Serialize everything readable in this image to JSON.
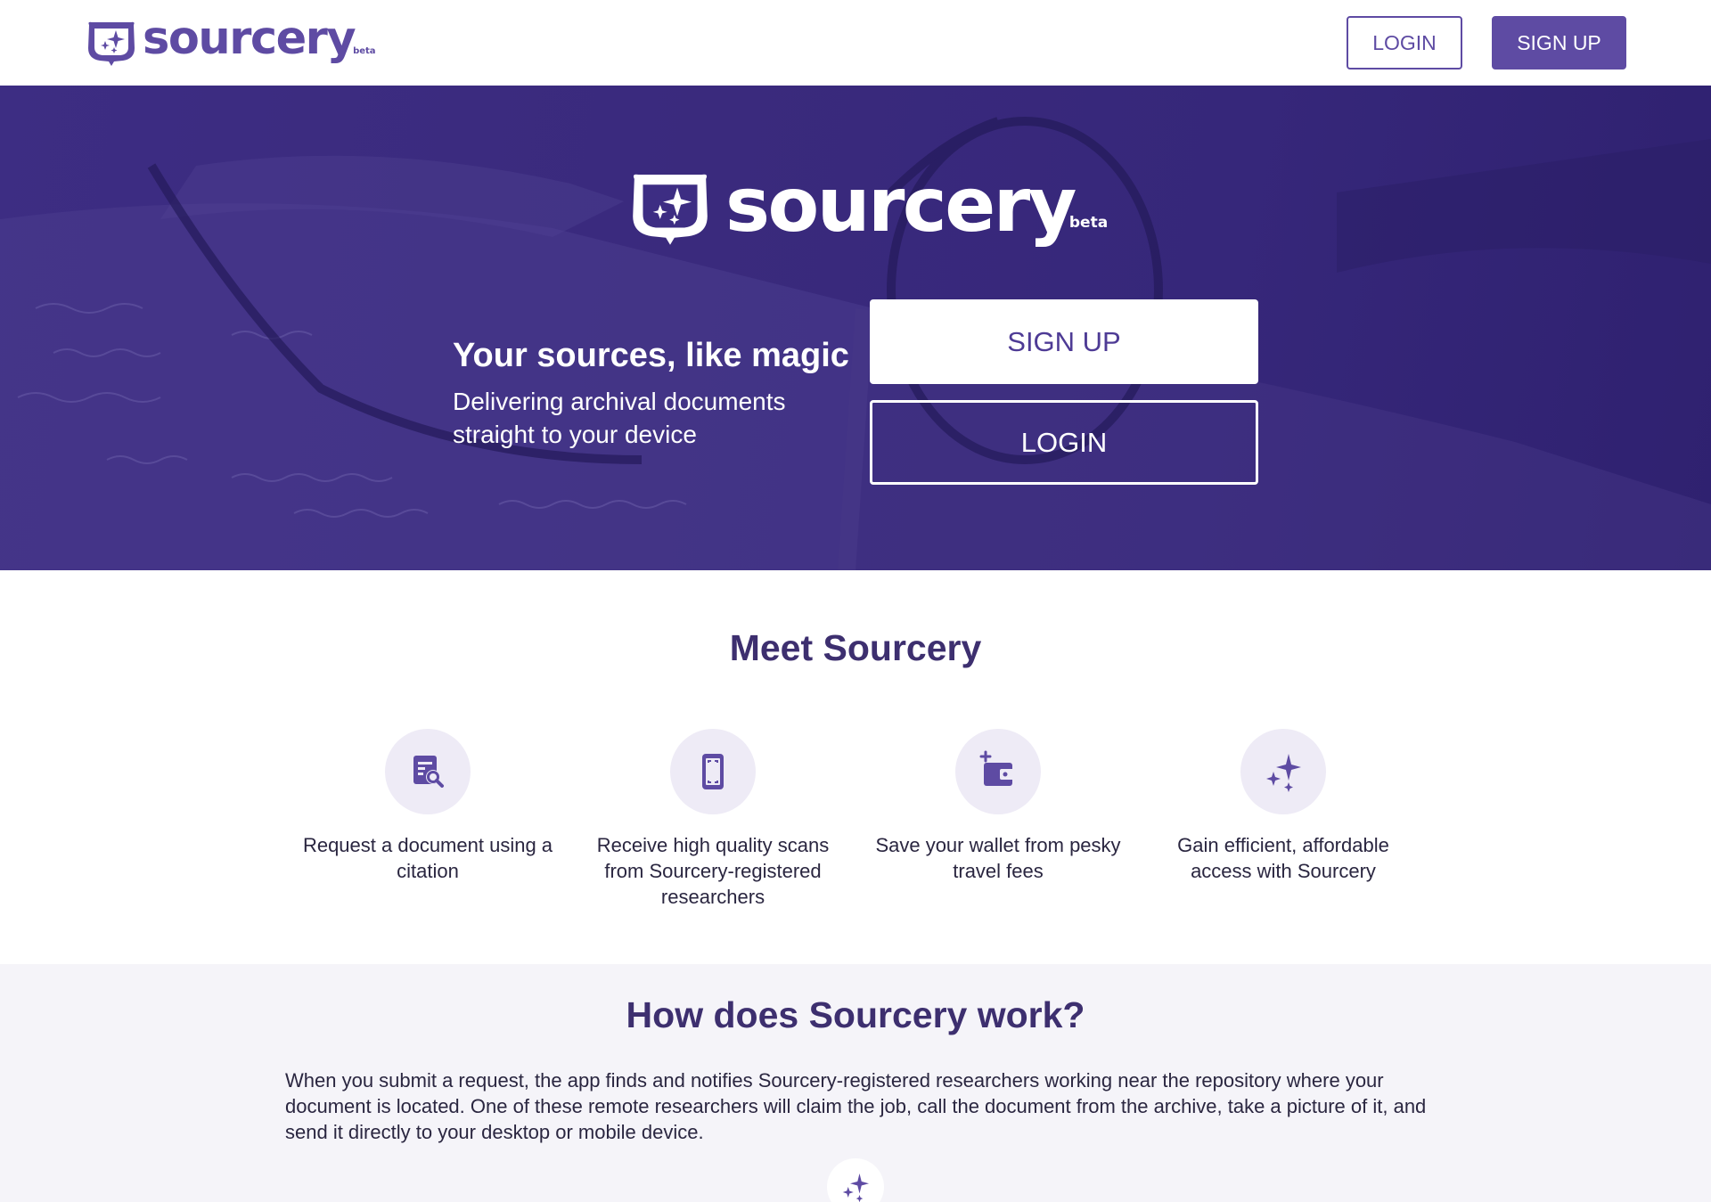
{
  "brand": {
    "name": "sourcery",
    "badge": "beta",
    "logo_icon": "cauldron-sparkle-icon",
    "color": "#5e4ba3"
  },
  "nav": {
    "login_label": "LOGIN",
    "signup_label": "SIGN UP"
  },
  "hero": {
    "headline": "Your sources, like magic",
    "subheadline": "Delivering archival documents straight to your device",
    "signup_label": "SIGN UP",
    "login_label": "LOGIN",
    "background_color": "#3a2a7d",
    "background_image": "open-notebook-with-glasses"
  },
  "meet": {
    "title": "Meet Sourcery",
    "features": [
      {
        "icon": "document-search-icon",
        "text": "Request a document using a citation"
      },
      {
        "icon": "phone-scan-icon",
        "text": "Receive high quality scans from Sourcery-registered researchers"
      },
      {
        "icon": "wallet-plus-icon",
        "text": "Save your wallet from pesky travel fees"
      },
      {
        "icon": "sparkles-icon",
        "text": "Gain efficient, affordable access with Sourcery"
      }
    ]
  },
  "how": {
    "title": "How does Sourcery work?",
    "text": "When you submit a request, the app finds and notifies Sourcery-registered researchers working near the repository where your document is located. One of these remote researchers will claim the job, call the document from the archive, take a picture of it, and send it directly to your desktop or mobile device.",
    "icon": "sparkles-icon"
  },
  "colors": {
    "accent": "#5e4ba3",
    "heading": "#3d2f6f",
    "section_bg": "#f5f4f9",
    "icon_circle": "#eeebf6"
  }
}
